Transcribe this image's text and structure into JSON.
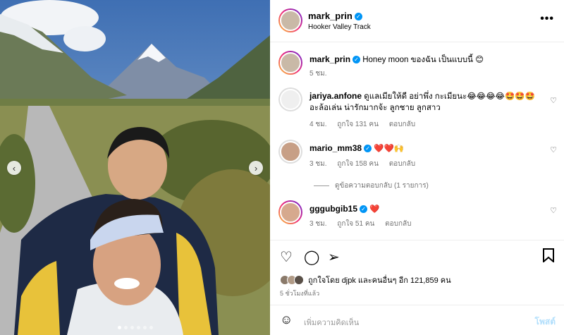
{
  "post": {
    "username": "mark_prin",
    "location": "Hooker Valley Track",
    "more_label": "•••"
  },
  "caption": {
    "username": "mark_prin",
    "text": "Honey moon ของฉัน เป็นแบบนี้ 😊",
    "time": "5 ชม."
  },
  "comments": [
    {
      "username": "jariya.anfone",
      "text": "ดูแลเมียให้ดี อย่าพึ่ง กะเมียนะ😂😂😂😂🤩🤩🤩 อะล้อเล่น น่ารักมากจ้ะ ลูกชาย ลูกสาว",
      "time": "4 ชม.",
      "likes": "ถูกใจ 131 คน",
      "reply": "ตอบกลับ"
    },
    {
      "username": "mario_mm38",
      "text": "❤️❤️🙌",
      "time": "3 ชม.",
      "likes": "ถูกใจ 158 คน",
      "reply": "ตอบกลับ"
    },
    {
      "username": "gggubgib15",
      "text": "❤️",
      "time": "3 ชม.",
      "likes": "ถูกใจ 51 คน",
      "reply": "ตอบกลับ"
    }
  ],
  "view_replies": "ดูข้อความตอบกลับ (1 รายการ)",
  "liked_by": "ถูกใจโดย djpk และคนอื่นๆ อีก 121,859 คน",
  "post_time": "5 ชั่วโมงที่แล้ว",
  "comment_box": {
    "placeholder": "เพิ่มความคิดเห็น",
    "post_label": "โพสต์"
  },
  "icons": {
    "nav_prev": "‹",
    "nav_next": "›",
    "heart": "♡",
    "comment": "◯",
    "share": "➢",
    "bookmark": "🔖",
    "emoji": "☺"
  },
  "carousel": {
    "count": 6,
    "active": 0
  }
}
